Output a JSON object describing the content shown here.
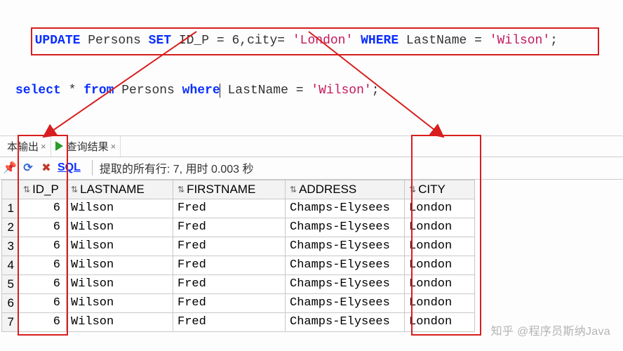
{
  "sql": {
    "line1": {
      "kw_update": "UPDATE",
      "tbl": " Persons ",
      "kw_set": "SET",
      "set1": " ID_P = 6,city= ",
      "str1": "'London'",
      "sp1": " ",
      "kw_where": "WHERE",
      "cond": " LastName = ",
      "str2": "'Wilson'",
      "end": ";"
    },
    "line2": {
      "kw_select": "select",
      "star": " * ",
      "kw_from": "from",
      "tbl": " Persons ",
      "kw_where": "where",
      "cond": " LastName = ",
      "str1": "'Wilson'",
      "end": ";"
    }
  },
  "tabs": {
    "script_output": "本输出",
    "query_results": "查询结果"
  },
  "toolbar": {
    "sql_label": "SQL",
    "status": "提取的所有行: 7, 用时 0.003 秒"
  },
  "grid": {
    "columns": [
      "ID_P",
      "LASTNAME",
      "FIRSTNAME",
      "ADDRESS",
      "CITY"
    ],
    "rows": [
      {
        "n": "1",
        "id_p": "6",
        "last": "Wilson",
        "first": "Fred",
        "addr": "Champs-Elysees",
        "city": "London"
      },
      {
        "n": "2",
        "id_p": "6",
        "last": "Wilson",
        "first": "Fred",
        "addr": "Champs-Elysees",
        "city": "London"
      },
      {
        "n": "3",
        "id_p": "6",
        "last": "Wilson",
        "first": "Fred",
        "addr": "Champs-Elysees",
        "city": "London"
      },
      {
        "n": "4",
        "id_p": "6",
        "last": "Wilson",
        "first": "Fred",
        "addr": "Champs-Elysees",
        "city": "London"
      },
      {
        "n": "5",
        "id_p": "6",
        "last": "Wilson",
        "first": "Fred",
        "addr": "Champs-Elysees",
        "city": "London"
      },
      {
        "n": "6",
        "id_p": "6",
        "last": "Wilson",
        "first": "Fred",
        "addr": "Champs-Elysees",
        "city": "London"
      },
      {
        "n": "7",
        "id_p": "6",
        "last": "Wilson",
        "first": "Fred",
        "addr": "Champs-Elysees",
        "city": "London"
      }
    ]
  },
  "watermark": "知乎 @程序员斯纳Java"
}
